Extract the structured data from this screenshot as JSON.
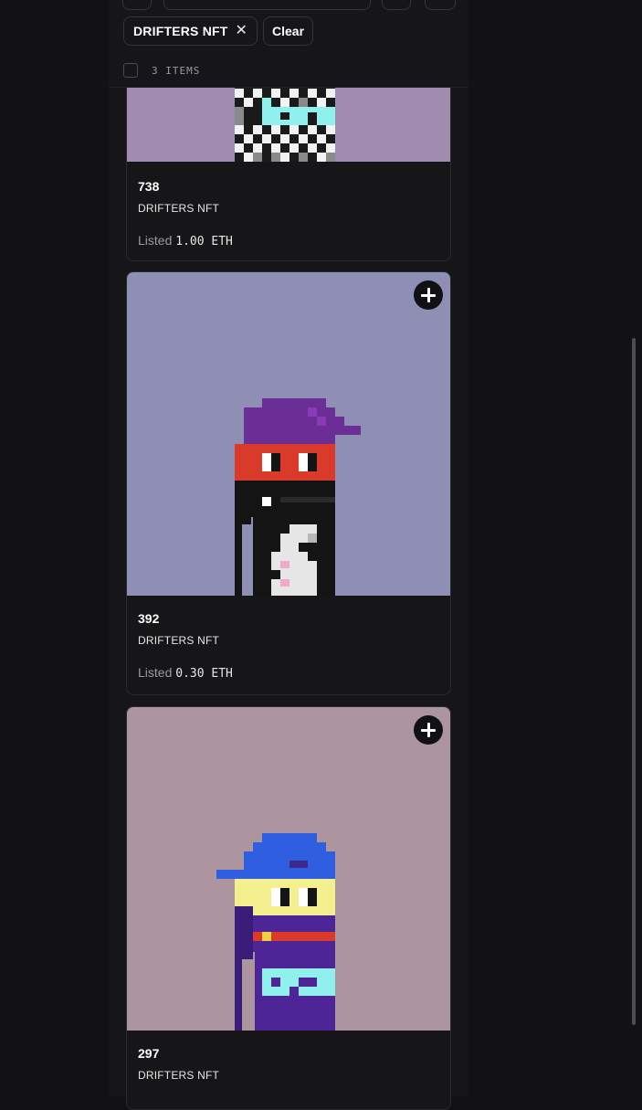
{
  "filter": {
    "chip_label": "DRIFTERS NFT",
    "chip_remove_icon": "close-icon",
    "clear_label": "Clear",
    "items_count": "3 ITEMS"
  },
  "cards": [
    {
      "token_id": "738",
      "collection": "DRIFTERS NFT",
      "listed_label": "Listed",
      "price": "1.00 ETH",
      "art_bg": "#a08cb0"
    },
    {
      "token_id": "392",
      "collection": "DRIFTERS NFT",
      "listed_label": "Listed",
      "price": "0.30 ETH",
      "art_bg": "#8f8eb4",
      "add_icon": "plus-icon"
    },
    {
      "token_id": "297",
      "collection": "DRIFTERS NFT",
      "art_bg": "#ad959f",
      "add_icon": "plus-icon"
    }
  ],
  "colors": {
    "page_bg": "#121214",
    "panel_bg": "#161618",
    "border": "#2a2a2e",
    "muted_text": "#9a9aa0"
  }
}
